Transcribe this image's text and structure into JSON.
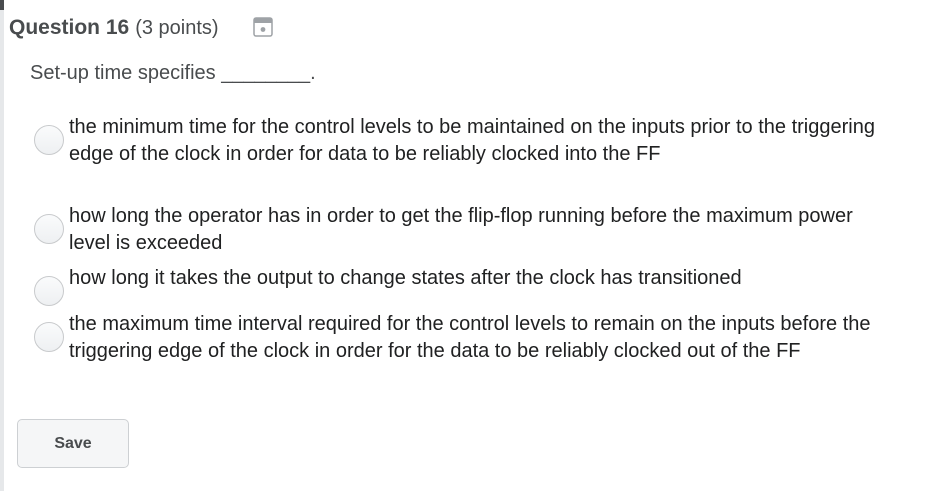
{
  "question": {
    "title": "Question 16",
    "points": "(3 points)",
    "flag_icon": "bookmark-flag-icon",
    "prompt": "Set-up time specifies ________."
  },
  "options": [
    {
      "label": "the minimum time for the control levels to be maintained on the inputs prior to the triggering edge of the clock in order for data to be reliably clocked into the FF",
      "selected": false
    },
    {
      "label": "how long the operator has in order to get the flip-flop running before the maximum power level is exceeded",
      "selected": false
    },
    {
      "label": "how long it takes the output to change states after the clock has transitioned",
      "selected": false
    },
    {
      "label": "the maximum time interval required for the control levels to remain on the inputs before the triggering edge of the clock in order for the data to be reliably clocked out of the FF",
      "selected": false
    }
  ],
  "actions": {
    "save_label": "Save"
  }
}
